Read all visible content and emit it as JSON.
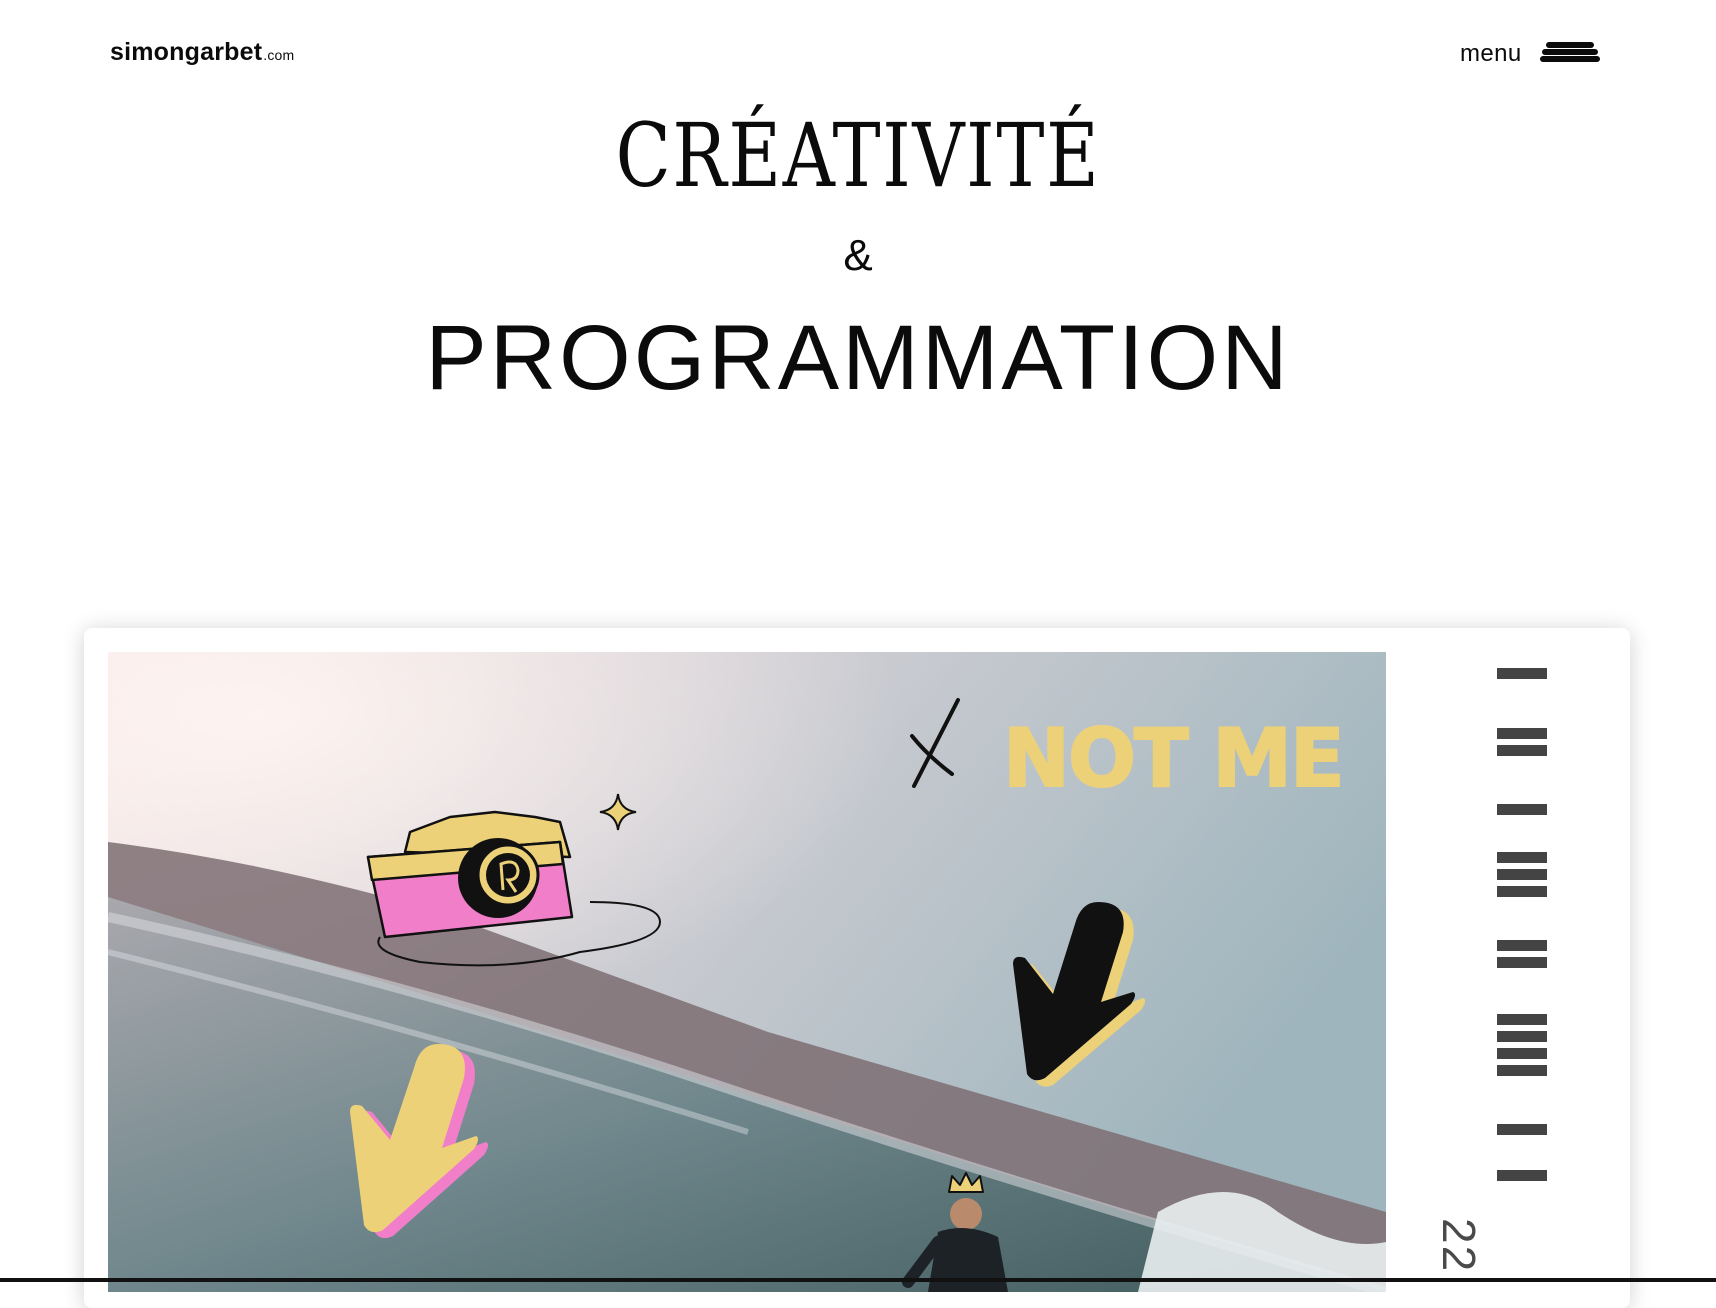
{
  "header": {
    "logo_main": "simongarbet",
    "logo_tld": ".com",
    "menu_label": "menu"
  },
  "hero": {
    "title": "CRÉATIVITÉ",
    "ampersand": "&",
    "subtitle": "PROGRAMMATION"
  },
  "card": {
    "sticker_text": "NOT ME",
    "year_partial": "22",
    "colors": {
      "yellow": "#ecd179",
      "pink": "#f07ec9",
      "black": "#111111",
      "tick": "#444444"
    },
    "icons": [
      "camera-icon",
      "sparkle-icon",
      "cross-icon",
      "arrow-down-left-icon",
      "crown-icon"
    ]
  }
}
